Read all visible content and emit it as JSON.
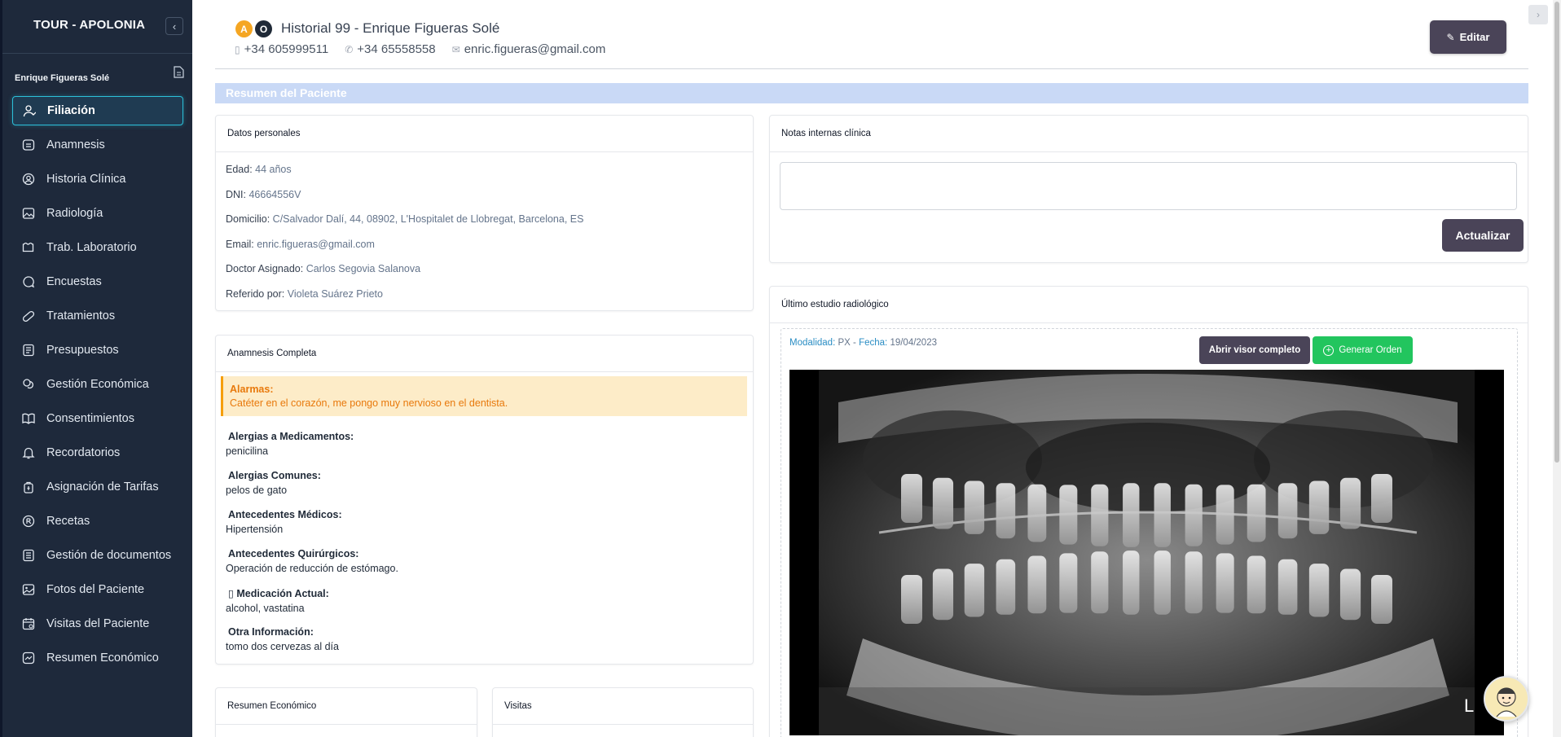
{
  "sidebar": {
    "title": "TOUR - APOLONIA",
    "collapse_icon": "chevron-left-icon",
    "patient_name": "Enrique Figueras Solé",
    "items": [
      {
        "label": "Filiación",
        "icon": "user-icon",
        "active": true
      },
      {
        "label": "Anamnesis",
        "icon": "message-square-icon"
      },
      {
        "label": "Historia Clínica",
        "icon": "user-circle-icon"
      },
      {
        "label": "Radiología",
        "icon": "image-icon"
      },
      {
        "label": "Trab. Laboratorio",
        "icon": "flask-icon"
      },
      {
        "label": "Encuestas",
        "icon": "chat-icon"
      },
      {
        "label": "Tratamientos",
        "icon": "pill-icon"
      },
      {
        "label": "Presupuestos",
        "icon": "receipt-icon"
      },
      {
        "label": "Gestión Económica",
        "icon": "coins-icon"
      },
      {
        "label": "Consentimientos",
        "icon": "book-open-icon"
      },
      {
        "label": "Recordatorios",
        "icon": "bell-icon"
      },
      {
        "label": "Asignación de Tarifas",
        "icon": "bag-icon"
      },
      {
        "label": "Recetas",
        "icon": "prescription-icon"
      },
      {
        "label": "Gestión de documentos",
        "icon": "folder-icon"
      },
      {
        "label": "Fotos del Paciente",
        "icon": "photo-icon"
      },
      {
        "label": "Visitas del Paciente",
        "icon": "calendar-icon"
      },
      {
        "label": "Resumen Económico",
        "icon": "chart-icon"
      }
    ]
  },
  "header": {
    "badges": [
      "A",
      "O"
    ],
    "title": "Historial 99 - Enrique Figueras Solé",
    "mobile": "+34 605999511",
    "phone": "+34 65558558",
    "email": "enric.figueras@gmail.com",
    "edit_label": "Editar"
  },
  "summary_title": "Resumen del Paciente",
  "datos": {
    "title": "Datos personales",
    "rows": [
      {
        "key": "Edad:",
        "value": "44 años"
      },
      {
        "key": "DNI:",
        "value": "46664556V"
      },
      {
        "key": "Domicilio:",
        "value": "C/Salvador Dalí, 44, 08902, L'Hospitalet de Llobregat, Barcelona, ES"
      },
      {
        "key": "Email:",
        "value": "enric.figueras@gmail.com"
      },
      {
        "key": "Doctor Asignado:",
        "value": "Carlos Segovia Salanova"
      },
      {
        "key": "Referido por:",
        "value": "Violeta Suárez Prieto"
      }
    ]
  },
  "notas": {
    "title": "Notas internas clínica",
    "value": "",
    "button": "Actualizar"
  },
  "radio": {
    "title": "Último estudio radiológico",
    "modalidad_key": "Modalidad:",
    "modalidad_value": "PX",
    "fecha_key": "Fecha:",
    "fecha_value": "19/04/2023",
    "btn_visor": "Abrir visor completo",
    "btn_orden": "Generar Orden",
    "xray_letter": "L"
  },
  "anamnesis": {
    "title": "Anamnesis Completa",
    "alarm_title": "Alarmas:",
    "alarm_text": "Catéter en el corazón, me pongo muy nervioso en el dentista.",
    "items": [
      {
        "key": "Alergias a Medicamentos:",
        "value": "penicilina"
      },
      {
        "key": "Alergias Comunes:",
        "value": "pelos de gato"
      },
      {
        "key": "Antecedentes Médicos:",
        "value": "Hipertensión"
      },
      {
        "key": "Antecedentes Quirúrgicos:",
        "value": "Operación de reducción de estómago."
      },
      {
        "key": "Medicación Actual:",
        "value": "alcohol, vastatina"
      },
      {
        "key": "Otra Información:",
        "value": "tomo dos cervezas al día"
      }
    ]
  },
  "resumen_economico": {
    "title": "Resumen Económico"
  },
  "visitas": {
    "title": "Visitas"
  }
}
